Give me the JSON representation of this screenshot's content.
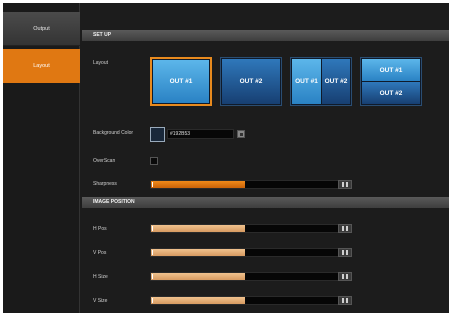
{
  "sidebar": {
    "tabs": [
      {
        "label": "Output",
        "active": false
      },
      {
        "label": "Layout",
        "active": true
      }
    ],
    "active_color": "#e07812"
  },
  "setup": {
    "header": "SET UP",
    "layout_label": "Layout",
    "layouts": [
      {
        "id": "single-out1",
        "panes": [
          "OUT #1"
        ],
        "selected": true
      },
      {
        "id": "single-out2",
        "panes": [
          "OUT #2"
        ],
        "selected": false
      },
      {
        "id": "split-vertical",
        "panes": [
          "OUT #1",
          "OUT #2"
        ],
        "selected": false
      },
      {
        "id": "split-horizontal",
        "panes": [
          "OUT #1",
          "OUT #2"
        ],
        "selected": false
      }
    ],
    "background_color_label": "Background Color",
    "background_color_value": "#192B53",
    "overscan_label": "OverScan",
    "overscan_checked": false,
    "sharpness_label": "Sharpness",
    "sharpness_value": "0",
    "sharpness_level": 0.5
  },
  "image_position": {
    "header": "IMAGE POSITION",
    "rows": [
      {
        "label": "H Pos",
        "value": "0",
        "level": 0.5
      },
      {
        "label": "V Pos",
        "value": "0",
        "level": 0.5
      },
      {
        "label": "H Size",
        "value": "0",
        "level": 0.5
      },
      {
        "label": "V Size",
        "value": "0",
        "level": 0.5
      }
    ]
  },
  "colors": {
    "accent": "#e07812",
    "slider_orange": "#e07812",
    "slider_tan": "#e8b27a",
    "thumb_blue": "#2a82c4"
  }
}
